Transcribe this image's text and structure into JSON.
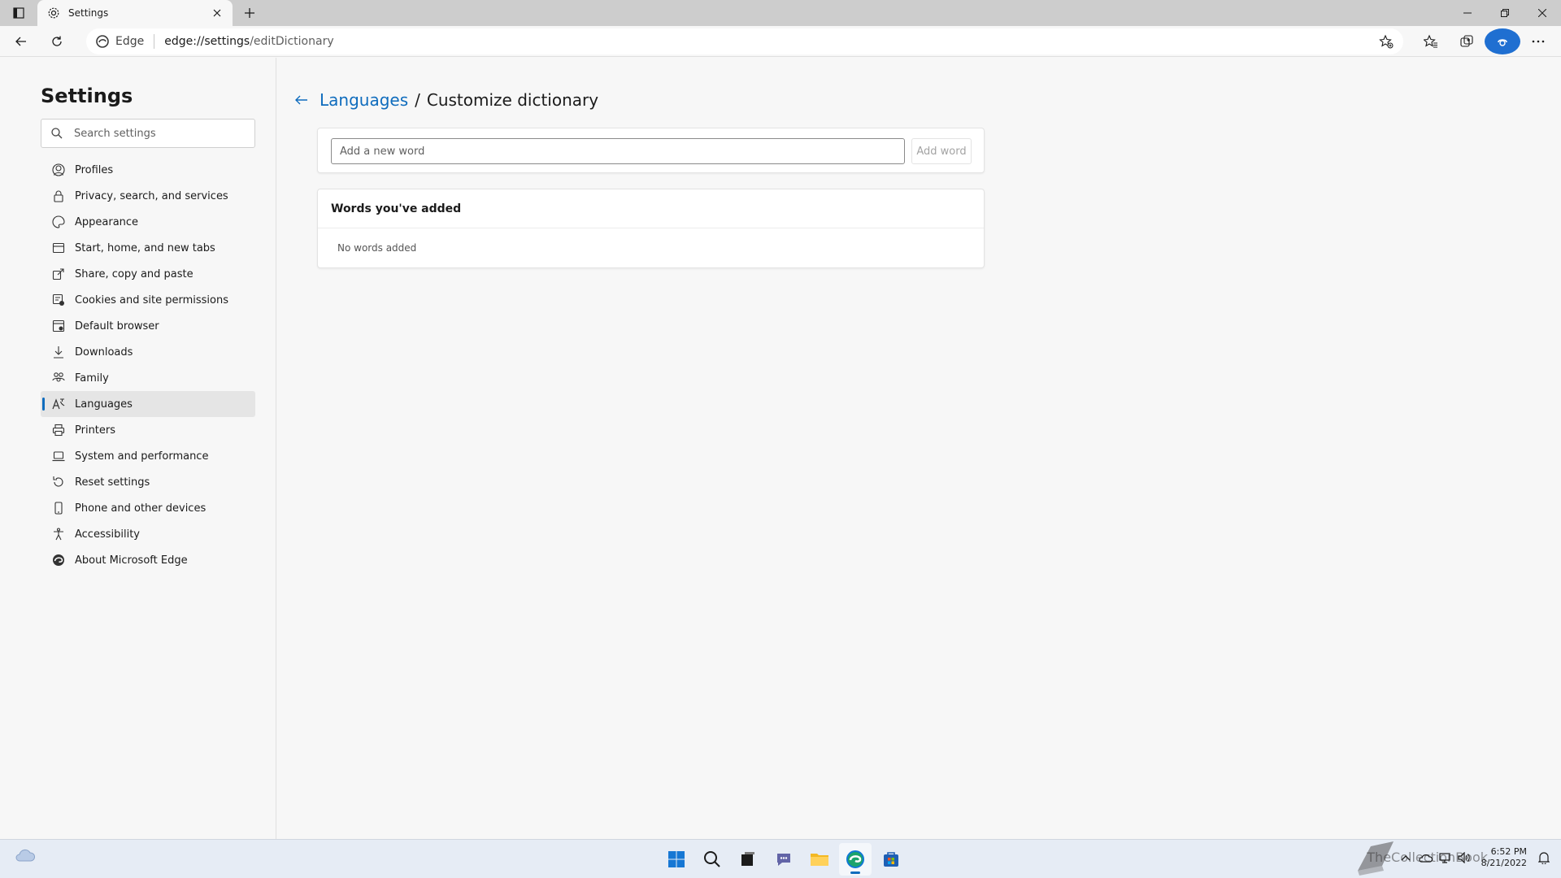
{
  "browser": {
    "tab_title": "Settings",
    "site_label": "Edge",
    "url_host": "edge://settings",
    "url_path": "/editDictionary"
  },
  "sidebar": {
    "title": "Settings",
    "search_placeholder": "Search settings",
    "items": [
      {
        "label": "Profiles",
        "icon": "profile-icon"
      },
      {
        "label": "Privacy, search, and services",
        "icon": "lock-icon"
      },
      {
        "label": "Appearance",
        "icon": "appearance-icon"
      },
      {
        "label": "Start, home, and new tabs",
        "icon": "home-tabs-icon"
      },
      {
        "label": "Share, copy and paste",
        "icon": "share-icon"
      },
      {
        "label": "Cookies and site permissions",
        "icon": "cookies-icon"
      },
      {
        "label": "Default browser",
        "icon": "browser-icon"
      },
      {
        "label": "Downloads",
        "icon": "download-icon"
      },
      {
        "label": "Family",
        "icon": "family-icon"
      },
      {
        "label": "Languages",
        "icon": "languages-icon",
        "active": true
      },
      {
        "label": "Printers",
        "icon": "printer-icon"
      },
      {
        "label": "System and performance",
        "icon": "laptop-icon"
      },
      {
        "label": "Reset settings",
        "icon": "reset-icon"
      },
      {
        "label": "Phone and other devices",
        "icon": "phone-icon"
      },
      {
        "label": "Accessibility",
        "icon": "accessibility-icon"
      },
      {
        "label": "About Microsoft Edge",
        "icon": "edge-icon"
      }
    ]
  },
  "main": {
    "breadcrumb_parent": "Languages",
    "breadcrumb_separator": "/",
    "breadcrumb_current": "Customize dictionary",
    "add_word_placeholder": "Add a new word",
    "add_word_button": "Add word",
    "words_header": "Words you've added",
    "words_empty": "No words added"
  },
  "taskbar": {
    "time": "6:52 PM",
    "date": "8/21/2022",
    "watermark": "TheCollectionBook"
  },
  "colors": {
    "accent": "#0f6cbd",
    "active_item_bg": "#e5e5e5"
  }
}
